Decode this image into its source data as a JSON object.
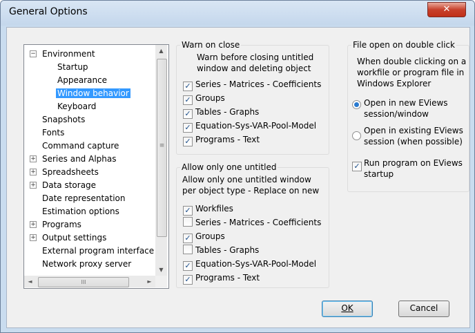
{
  "window": {
    "title": "General Options",
    "close_glyph": "✕"
  },
  "tree": {
    "items": [
      {
        "label": "Environment",
        "level": 0,
        "expander": "−"
      },
      {
        "label": "Startup",
        "level": 1
      },
      {
        "label": "Appearance",
        "level": 1
      },
      {
        "label": "Window behavior",
        "level": 1,
        "selected": true
      },
      {
        "label": "Keyboard",
        "level": 1
      },
      {
        "label": "Snapshots",
        "level": 0
      },
      {
        "label": "Fonts",
        "level": 0
      },
      {
        "label": "Command capture",
        "level": 0
      },
      {
        "label": "Series and Alphas",
        "level": 0,
        "expander": "+"
      },
      {
        "label": "Spreadsheets",
        "level": 0,
        "expander": "+"
      },
      {
        "label": "Data storage",
        "level": 0,
        "expander": "+"
      },
      {
        "label": "Date representation",
        "level": 0
      },
      {
        "label": "Estimation options",
        "level": 0
      },
      {
        "label": "Programs",
        "level": 0,
        "expander": "+"
      },
      {
        "label": "Output settings",
        "level": 0,
        "expander": "+"
      },
      {
        "label": "External program interface",
        "level": 0
      },
      {
        "label": "Network proxy server",
        "level": 0
      }
    ],
    "scroll": {
      "up": "▲",
      "down": "▼",
      "left": "◄",
      "right": "►",
      "grip": "≡",
      "hgrip": "III"
    }
  },
  "warn": {
    "title": "Warn on close",
    "note": "Warn before closing untitled window and deleting object",
    "items": [
      {
        "label": "Series - Matrices - Coefficients",
        "checked": true
      },
      {
        "label": "Groups",
        "checked": true
      },
      {
        "label": "Tables - Graphs",
        "checked": true
      },
      {
        "label": "Equation-Sys-VAR-Pool-Model",
        "checked": true
      },
      {
        "label": "Programs - Text",
        "checked": true
      }
    ]
  },
  "allow": {
    "title": "Allow only one untitled",
    "note": "Allow only one untitled window per object type - Replace on new",
    "items": [
      {
        "label": "Workfiles",
        "checked": true
      },
      {
        "label": "Series - Matrices - Coefficients",
        "checked": false
      },
      {
        "label": "Groups",
        "checked": true
      },
      {
        "label": "Tables - Graphs",
        "checked": false
      },
      {
        "label": "Equation-Sys-VAR-Pool-Model",
        "checked": true
      },
      {
        "label": "Programs - Text",
        "checked": true
      }
    ]
  },
  "fileopen": {
    "title": "File open on double click",
    "note": "When double clicking on a workfile or program file in Windows Explorer",
    "radio_new": "Open in new EViews session/window",
    "radio_existing": "Open in existing EViews session (when possible)",
    "selected": "new",
    "run_program": "Run program on EViews startup",
    "run_checked": true
  },
  "buttons": {
    "ok": "OK",
    "cancel": "Cancel"
  }
}
